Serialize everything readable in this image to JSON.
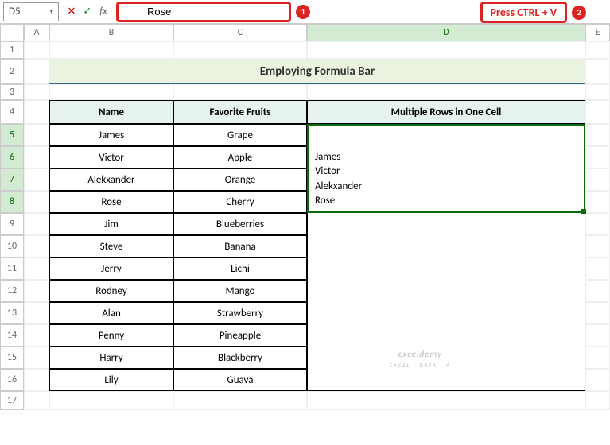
{
  "formula_bar": {
    "name_box": "D5",
    "formula": "Rose"
  },
  "annotations": {
    "badge1": "1",
    "press_label": "Press CTRL + V",
    "badge2": "2"
  },
  "columns": [
    "",
    "A",
    "B",
    "C",
    "D",
    "E"
  ],
  "rows": [
    "1",
    "2",
    "3",
    "4",
    "5",
    "6",
    "7",
    "8",
    "9",
    "10",
    "11",
    "12",
    "13",
    "14",
    "15",
    "16",
    "17"
  ],
  "title": "Employing Formula Bar",
  "headers": {
    "name": "Name",
    "fruit": "Favorite Fruits",
    "multi": "Multiple Rows in One Cell"
  },
  "data": [
    {
      "name": "James",
      "fruit": "Grape"
    },
    {
      "name": "Victor",
      "fruit": "Apple"
    },
    {
      "name": "Alekxander",
      "fruit": "Orange"
    },
    {
      "name": "Rose",
      "fruit": "Cherry"
    },
    {
      "name": "Jim",
      "fruit": "Blueberries"
    },
    {
      "name": "Steve",
      "fruit": "Banana"
    },
    {
      "name": "Jerry",
      "fruit": "Lichi"
    },
    {
      "name": "Rodney",
      "fruit": "Mango"
    },
    {
      "name": "Alan",
      "fruit": "Strawberry"
    },
    {
      "name": "Penny",
      "fruit": "Pineapple"
    },
    {
      "name": "Harry",
      "fruit": "Blackberry"
    },
    {
      "name": "Lily",
      "fruit": "Guava"
    }
  ],
  "multi_cell_lines": [
    "James",
    "Victor",
    "Alekxander",
    "Rose"
  ],
  "watermark": {
    "main": "exceldemy",
    "sub": "EXCEL · DATA · A"
  }
}
